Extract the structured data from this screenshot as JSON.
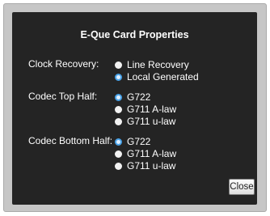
{
  "dialog": {
    "title": "E-Que Card Properties",
    "close_label": "Close",
    "accent_color": "#4aa3e8",
    "panel_color": "#242424"
  },
  "clock_recovery": {
    "label": "Clock Recovery:",
    "options": [
      {
        "label": "Line Recovery",
        "selected": false
      },
      {
        "label": "Local Generated",
        "selected": true
      }
    ]
  },
  "codec_top": {
    "label": "Codec Top Half:",
    "options": [
      {
        "label": "G722",
        "selected": true
      },
      {
        "label": "G711 A-law",
        "selected": false
      },
      {
        "label": "G711 u-law",
        "selected": false
      }
    ]
  },
  "codec_bottom": {
    "label": "Codec Bottom Half:",
    "options": [
      {
        "label": "G722",
        "selected": true
      },
      {
        "label": "G711 A-law",
        "selected": false
      },
      {
        "label": "G711 u-law",
        "selected": false
      }
    ]
  }
}
